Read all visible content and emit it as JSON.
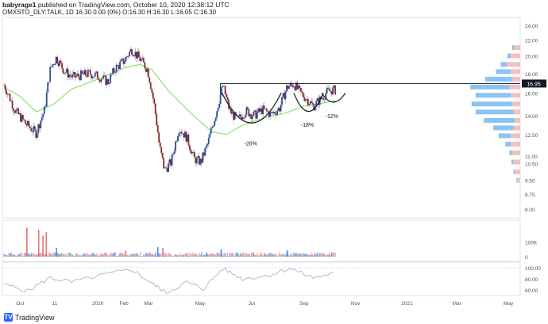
{
  "header": {
    "user": "babyrage1",
    "published_text": "published on TradingView.com, October 10, 2020 12:38:12 UTC",
    "symbol_line": "OMXSTO_DLY:TALK, 1D  16.30  0.00 (0%)  O:16.30  H:16.30  L:16.05  C:16.30"
  },
  "footer": {
    "brand": "TradingView",
    "brand_icon": "tradingview-logo-icon"
  },
  "colors": {
    "up": "#2a4a9c",
    "down": "#8b2a2a",
    "ma": "#8fe36a",
    "rsi": "#9aa0a8",
    "profile_up": "#7fbdf0",
    "profile_down": "#f4b8b8",
    "last_price_tag": "#131722"
  },
  "chart_data": [
    {
      "type": "candlestick",
      "title": "",
      "scale": "log",
      "y_ticks": [
        "24.00",
        "22.00",
        "20.00",
        "18.00",
        "16.00",
        "14.00",
        "12.50",
        "11.00",
        "10.50",
        "9.50",
        "8.75",
        "8.00"
      ],
      "y_tick_values": [
        24,
        22,
        20,
        18,
        16,
        14,
        12.5,
        11,
        10.5,
        9.5,
        8.75,
        8
      ],
      "x_ticks": [
        "Oct",
        "11",
        "2020",
        "Feb",
        "Mar",
        "May",
        "Jul",
        "Sep",
        "Nov",
        "2021",
        "Mar",
        "May"
      ],
      "x_tick_dates": [
        "2019-10-01",
        "2019-11-11",
        "2020-01-01",
        "2020-02-01",
        "2020-03-01",
        "2020-05-01",
        "2020-07-01",
        "2020-09-01",
        "2020-11-01",
        "2021-01-01",
        "2021-03-01",
        "2021-05-01"
      ],
      "last_price": "16.95",
      "ohlc_close_series": [
        {
          "date": "2019-09-12",
          "close": 16.8
        },
        {
          "date": "2019-09-25",
          "close": 14.4
        },
        {
          "date": "2019-10-08",
          "close": 13.3
        },
        {
          "date": "2019-10-20",
          "close": 12.6
        },
        {
          "date": "2019-10-30",
          "close": 14.5
        },
        {
          "date": "2019-11-06",
          "close": 18.6
        },
        {
          "date": "2019-11-13",
          "close": 19.8
        },
        {
          "date": "2019-11-22",
          "close": 18.3
        },
        {
          "date": "2019-12-02",
          "close": 17.6
        },
        {
          "date": "2019-12-12",
          "close": 17.8
        },
        {
          "date": "2019-12-22",
          "close": 18.0
        },
        {
          "date": "2020-01-02",
          "close": 17.7
        },
        {
          "date": "2020-01-13",
          "close": 17.1
        },
        {
          "date": "2020-01-22",
          "close": 18.6
        },
        {
          "date": "2020-02-01",
          "close": 19.4
        },
        {
          "date": "2020-02-10",
          "close": 20.8
        },
        {
          "date": "2020-02-20",
          "close": 19.6
        },
        {
          "date": "2020-02-29",
          "close": 18.4
        },
        {
          "date": "2020-03-08",
          "close": 14.8
        },
        {
          "date": "2020-03-14",
          "close": 11.6
        },
        {
          "date": "2020-03-20",
          "close": 10.1
        },
        {
          "date": "2020-03-28",
          "close": 10.6
        },
        {
          "date": "2020-04-06",
          "close": 13.0
        },
        {
          "date": "2020-04-15",
          "close": 12.3
        },
        {
          "date": "2020-04-24",
          "close": 10.8
        },
        {
          "date": "2020-05-02",
          "close": 10.6
        },
        {
          "date": "2020-05-10",
          "close": 11.8
        },
        {
          "date": "2020-05-20",
          "close": 14.2
        },
        {
          "date": "2020-05-28",
          "close": 16.7
        },
        {
          "date": "2020-06-05",
          "close": 14.4
        },
        {
          "date": "2020-06-14",
          "close": 13.6
        },
        {
          "date": "2020-06-24",
          "close": 14.4
        },
        {
          "date": "2020-07-04",
          "close": 14.0
        },
        {
          "date": "2020-07-14",
          "close": 14.5
        },
        {
          "date": "2020-07-24",
          "close": 14.1
        },
        {
          "date": "2020-08-03",
          "close": 14.6
        },
        {
          "date": "2020-08-12",
          "close": 16.6
        },
        {
          "date": "2020-08-20",
          "close": 16.9
        },
        {
          "date": "2020-08-28",
          "close": 16.0
        },
        {
          "date": "2020-09-05",
          "close": 15.4
        },
        {
          "date": "2020-09-12",
          "close": 14.8
        },
        {
          "date": "2020-09-20",
          "close": 15.4
        },
        {
          "date": "2020-09-28",
          "close": 16.1
        },
        {
          "date": "2020-10-04",
          "close": 16.3
        },
        {
          "date": "2020-10-09",
          "close": 16.3
        }
      ],
      "moving_average": [
        {
          "date": "2019-09-12",
          "value": 16.6
        },
        {
          "date": "2019-10-01",
          "value": 15.7
        },
        {
          "date": "2019-10-20",
          "value": 14.3
        },
        {
          "date": "2019-11-10",
          "value": 15.0
        },
        {
          "date": "2019-12-01",
          "value": 16.4
        },
        {
          "date": "2020-01-01",
          "value": 17.4
        },
        {
          "date": "2020-02-01",
          "value": 18.6
        },
        {
          "date": "2020-02-20",
          "value": 19.0
        },
        {
          "date": "2020-03-05",
          "value": 18.4
        },
        {
          "date": "2020-03-25",
          "value": 16.2
        },
        {
          "date": "2020-04-20",
          "value": 14.2
        },
        {
          "date": "2020-05-15",
          "value": 12.7
        },
        {
          "date": "2020-06-01",
          "value": 12.5
        },
        {
          "date": "2020-06-20",
          "value": 13.2
        },
        {
          "date": "2020-07-15",
          "value": 13.8
        },
        {
          "date": "2020-08-10",
          "value": 14.2
        },
        {
          "date": "2020-09-01",
          "value": 14.8
        },
        {
          "date": "2020-10-09",
          "value": 15.3
        }
      ],
      "resistance_line": {
        "value": 16.95,
        "from": "2020-05-25",
        "to": "2021-05-15"
      },
      "annotations": [
        {
          "text": "-26%",
          "date": "2020-06-30",
          "value": 11.7
        },
        {
          "text": "-18%",
          "date": "2020-09-05",
          "value": 13.1
        },
        {
          "text": "-12%",
          "date": "2020-10-04",
          "value": 13.8
        }
      ],
      "volume_profile": [
        {
          "price": 21.0,
          "up": 3,
          "down": 9
        },
        {
          "price": 20.0,
          "up": 5,
          "down": 14
        },
        {
          "price": 19.0,
          "up": 9,
          "down": 20
        },
        {
          "price": 18.2,
          "up": 22,
          "down": 14
        },
        {
          "price": 17.4,
          "up": 40,
          "down": 12
        },
        {
          "price": 16.6,
          "up": 58,
          "down": 16
        },
        {
          "price": 15.8,
          "up": 52,
          "down": 14
        },
        {
          "price": 15.0,
          "up": 60,
          "down": 12
        },
        {
          "price": 14.3,
          "up": 56,
          "down": 10
        },
        {
          "price": 13.6,
          "up": 46,
          "down": 8
        },
        {
          "price": 13.0,
          "up": 30,
          "down": 10
        },
        {
          "price": 12.4,
          "up": 18,
          "down": 14
        },
        {
          "price": 11.8,
          "up": 8,
          "down": 14
        },
        {
          "price": 11.2,
          "up": 4,
          "down": 12
        },
        {
          "price": 10.6,
          "up": 3,
          "down": 10
        },
        {
          "price": 10.0,
          "up": 2,
          "down": 8
        },
        {
          "price": 9.5,
          "up": 1,
          "down": 5
        }
      ]
    },
    {
      "type": "bar",
      "title": "",
      "y_ticks": [
        "100K",
        "0"
      ],
      "y_tick_values": [
        100000,
        0
      ],
      "volume": [
        {
          "date": "2019-10-09",
          "value": 200000,
          "up": false
        },
        {
          "date": "2019-10-23",
          "value": 185000,
          "up": false
        },
        {
          "date": "2019-10-28",
          "value": 145000,
          "up": false
        },
        {
          "date": "2019-11-01",
          "value": 170000,
          "up": false
        },
        {
          "date": "2019-11-13",
          "value": 60000,
          "up": true
        },
        {
          "date": "2020-02-03",
          "value": 40000,
          "up": false
        },
        {
          "date": "2020-03-12",
          "value": 65000,
          "up": true
        },
        {
          "date": "2020-03-18",
          "value": 60000,
          "up": false
        },
        {
          "date": "2020-05-26",
          "value": 50000,
          "up": true
        },
        {
          "date": "2020-08-12",
          "value": 45000,
          "up": true
        }
      ],
      "volume_baseline": 18000
    },
    {
      "type": "line",
      "title": "",
      "y_ticks": [
        "100.00",
        "80.00",
        "60.00"
      ],
      "y_tick_values": [
        100,
        80,
        60
      ],
      "series": [
        {
          "values": [
            {
              "date": "2019-09-12",
              "value": 70
            },
            {
              "date": "2019-10-10",
              "value": 58
            },
            {
              "date": "2019-11-05",
              "value": 82
            },
            {
              "date": "2019-12-01",
              "value": 74
            },
            {
              "date": "2020-01-10",
              "value": 88
            },
            {
              "date": "2020-02-10",
              "value": 97
            },
            {
              "date": "2020-03-05",
              "value": 72
            },
            {
              "date": "2020-03-22",
              "value": 55
            },
            {
              "date": "2020-04-15",
              "value": 74
            },
            {
              "date": "2020-05-05",
              "value": 62
            },
            {
              "date": "2020-05-28",
              "value": 99
            },
            {
              "date": "2020-06-20",
              "value": 80
            },
            {
              "date": "2020-07-20",
              "value": 86
            },
            {
              "date": "2020-08-15",
              "value": 99
            },
            {
              "date": "2020-09-12",
              "value": 82
            },
            {
              "date": "2020-10-09",
              "value": 91
            }
          ]
        }
      ]
    }
  ]
}
